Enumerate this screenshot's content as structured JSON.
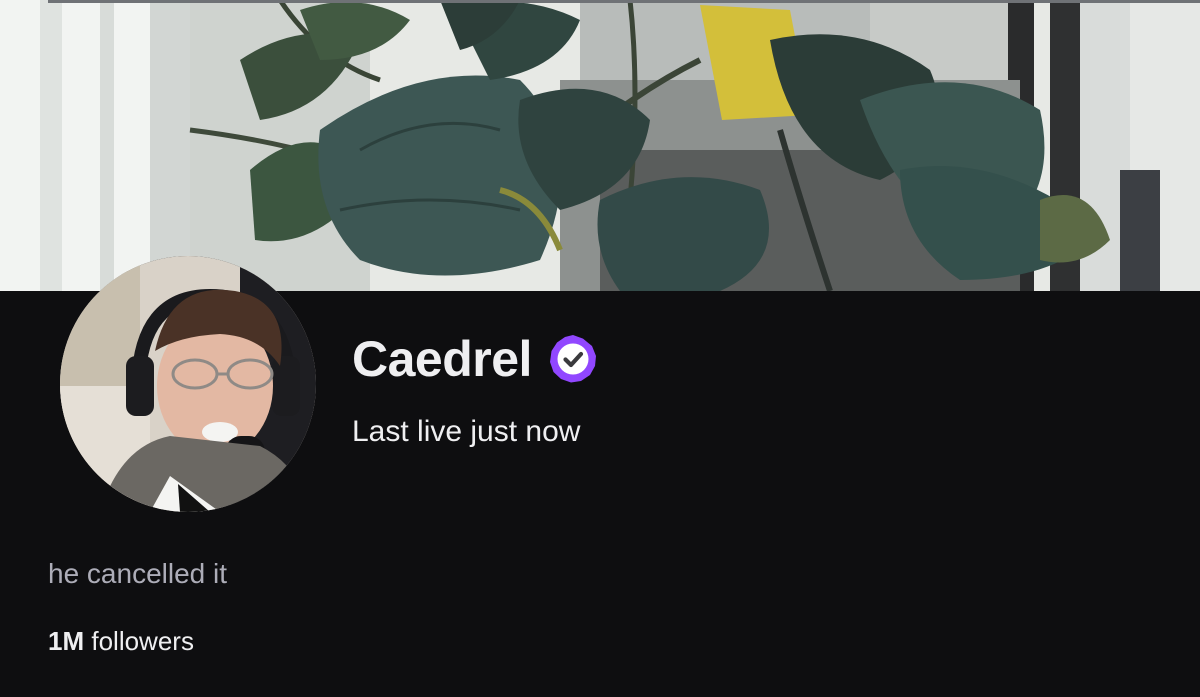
{
  "channel": {
    "name": "Caedrel",
    "last_live": "Last live just now",
    "bio": "he cancelled it",
    "followers_count": "1M",
    "followers_label": "followers",
    "verified": true
  },
  "colors": {
    "page_background": "#0e0e10",
    "primary_text": "#efeff1",
    "secondary_text": "#adadb8",
    "verified_badge": "#9147ff"
  },
  "icons": {
    "verified": "verified-badge-icon"
  }
}
